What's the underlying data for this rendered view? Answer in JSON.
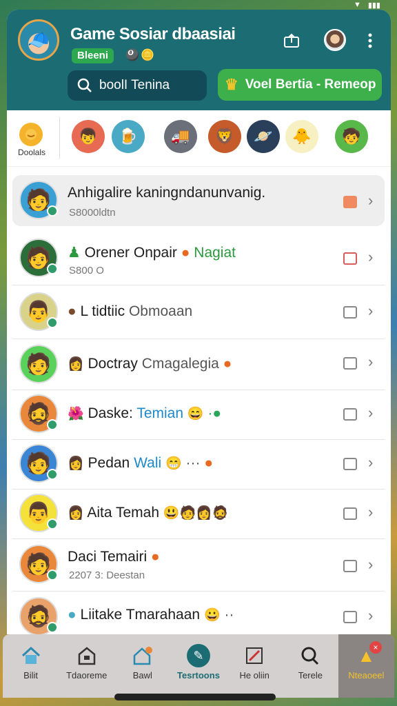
{
  "header": {
    "title": "Game Sosiar dbaasiai",
    "badge": "Bleeni",
    "search_label": "boolI Tenina",
    "green_button_label": "Voel Bertia - Remeop"
  },
  "stories": {
    "first_label": "Doolals"
  },
  "rows": [
    {
      "name": "Anhigalire kaningndanunvanig.",
      "sub": "S8000ldtn"
    },
    {
      "name": "Orener Onpair",
      "name_extra": "Nagiat",
      "sub": "S800 O"
    },
    {
      "name": "L tidtiic",
      "name_extra": "Obmoaan"
    },
    {
      "name": "Doctray",
      "name_extra": "Cmagalegia"
    },
    {
      "name": "Daske:",
      "name_extra": "Temian"
    },
    {
      "name": "Pedan",
      "name_extra": "Wali"
    },
    {
      "name": "Aita Temah"
    },
    {
      "name": "Daci Temairi",
      "sub": "2207 3: Deestan"
    },
    {
      "name": "Liitake Tmarahaan"
    }
  ],
  "nav": [
    {
      "label": "Bilit"
    },
    {
      "label": "Tdaoreme"
    },
    {
      "label": "Bawl"
    },
    {
      "label": "Tesrtoons"
    },
    {
      "label": "He oliin"
    },
    {
      "label": "Terele"
    },
    {
      "label": "Nteaoeel"
    }
  ],
  "colors": {
    "header_bg": "#1b6d73",
    "accent_green": "#3db04c",
    "link_blue": "#1e88c9"
  }
}
